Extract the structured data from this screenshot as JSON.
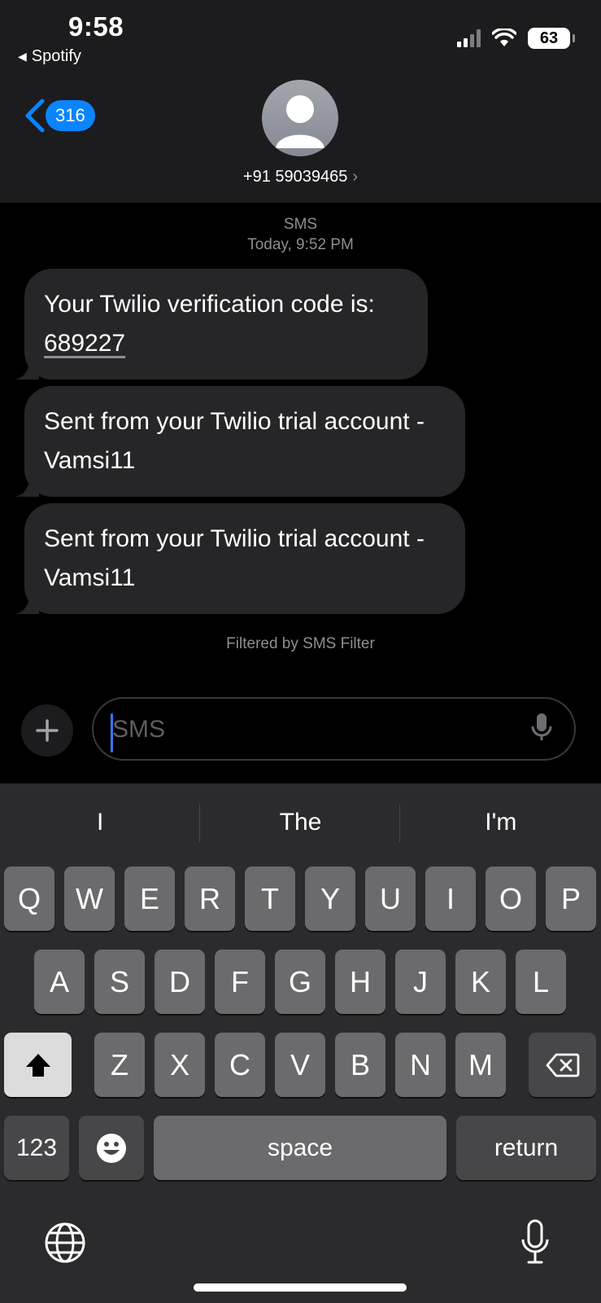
{
  "status_bar": {
    "time": "9:58",
    "back_app": "Spotify",
    "battery": "63"
  },
  "header": {
    "unread_count": "316",
    "contact": "+91 59039465"
  },
  "conversation": {
    "service": "SMS",
    "timestamp": "Today, 9:52 PM",
    "messages": [
      {
        "text": "Your Twilio verification code is:",
        "code": "689227"
      },
      {
        "text": "Sent from your Twilio trial account - Vamsi11"
      },
      {
        "text": "Sent from your Twilio trial account - Vamsi11"
      }
    ],
    "filter_note": "Filtered by SMS Filter"
  },
  "compose": {
    "placeholder": "SMS"
  },
  "keyboard": {
    "suggestions": [
      "I",
      "The",
      "I'm"
    ],
    "row1": [
      "Q",
      "W",
      "E",
      "R",
      "T",
      "Y",
      "U",
      "I",
      "O",
      "P"
    ],
    "row2": [
      "A",
      "S",
      "D",
      "F",
      "G",
      "H",
      "J",
      "K",
      "L"
    ],
    "row3": [
      "Z",
      "X",
      "C",
      "V",
      "B",
      "N",
      "M"
    ],
    "numbers_key": "123",
    "space_key": "space",
    "return_key": "return"
  },
  "icons": [
    "back-chevron-icon",
    "contact-avatar-icon",
    "plus-icon",
    "microphone-icon",
    "shift-icon",
    "delete-icon",
    "emoji-icon",
    "globe-icon",
    "dictation-icon",
    "wifi-icon",
    "cellular-signal-icon",
    "battery-icon"
  ]
}
